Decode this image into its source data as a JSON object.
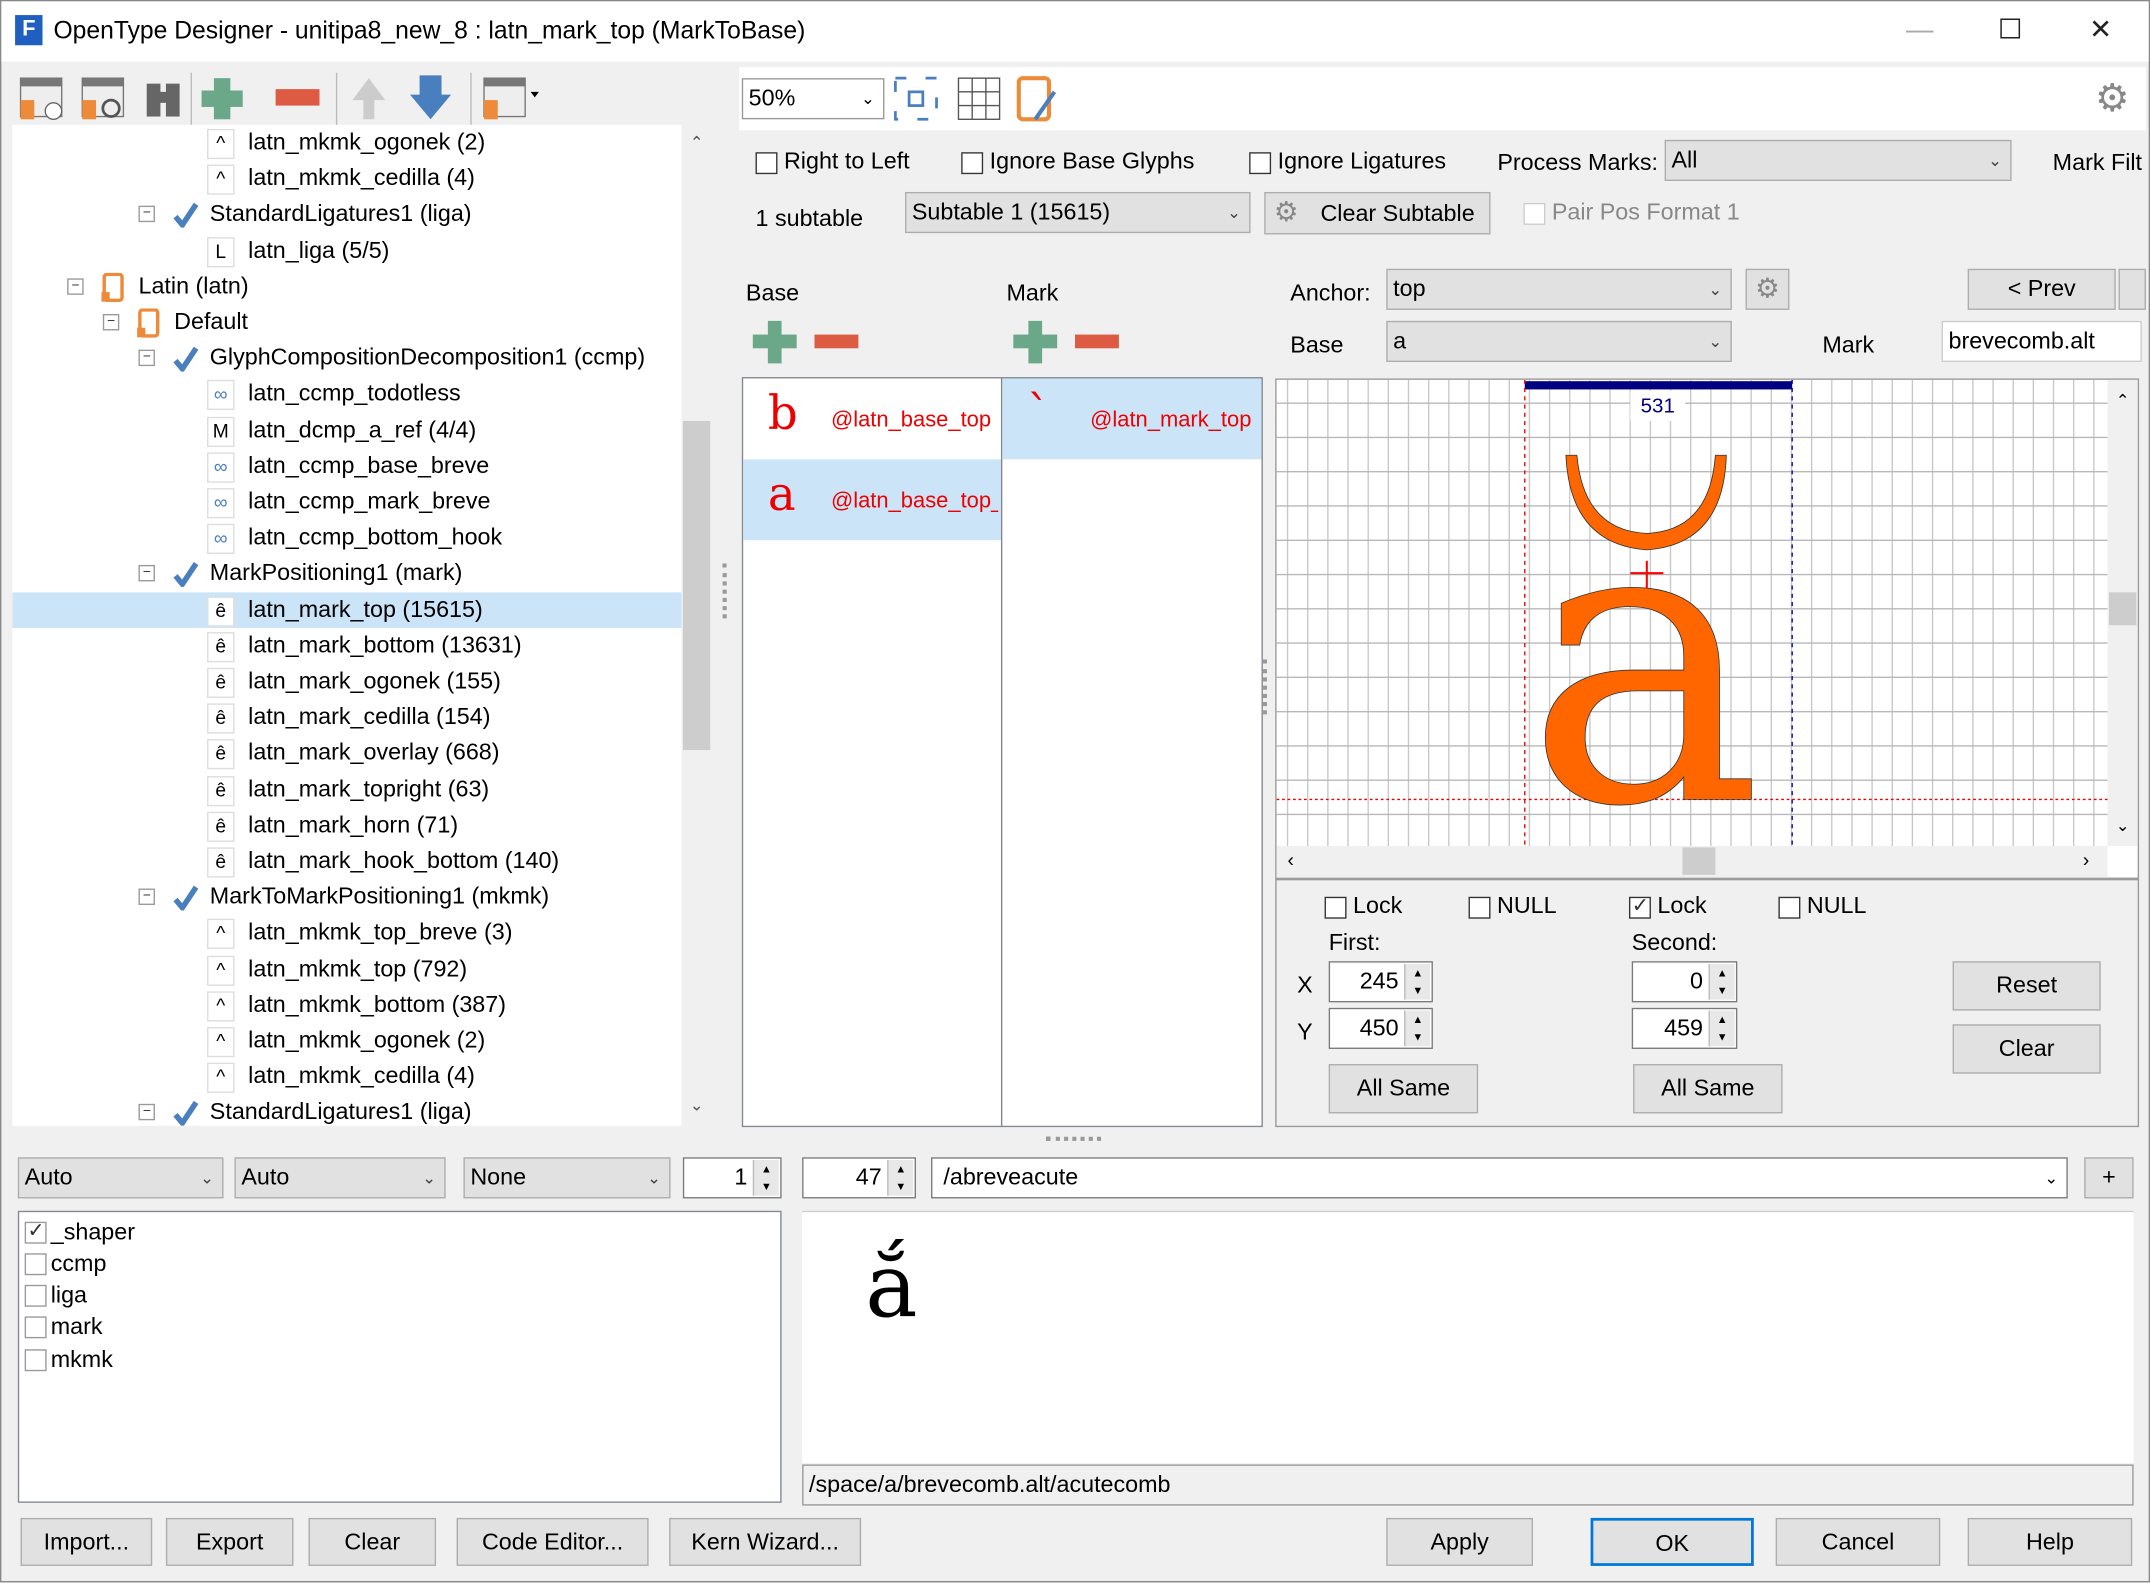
{
  "window": {
    "title": "OpenType Designer - unitipa8_new_8 : latn_mark_top (MarkToBase)",
    "minimize": "—",
    "maximize": "☐",
    "close": "✕"
  },
  "colors": {
    "accent_orange": "#ff6600",
    "selection": "#cce4f7",
    "anchor_red": "#ff0000",
    "advance_bar": "#000080",
    "add_green": "#6aa889",
    "remove_red": "#dd5a43"
  },
  "toolbar_left": [
    "new-lookup-icon",
    "find-lookup-icon",
    "binoculars-icon",
    "add-icon",
    "remove-icon",
    "move-up-icon",
    "move-down-icon",
    "view-menu-icon"
  ],
  "tree": [
    {
      "label": "latn_mkmk_ogonek (2)",
      "depth": 3,
      "icon": "mkmk"
    },
    {
      "label": "latn_mkmk_cedilla (4)",
      "depth": 3,
      "icon": "mkmk"
    },
    {
      "label": "StandardLigatures1 (liga)",
      "depth": 2,
      "icon": "feature"
    },
    {
      "label": "latn_liga (5/5)",
      "depth": 3,
      "icon": "liga"
    },
    {
      "label": "Latin (latn)",
      "depth": 0,
      "icon": "script"
    },
    {
      "label": "Default",
      "depth": 1,
      "icon": "script"
    },
    {
      "label": "GlyphCompositionDecomposition1 (ccmp)",
      "depth": 2,
      "icon": "feature"
    },
    {
      "label": "latn_ccmp_todotless",
      "depth": 3,
      "icon": "ccmp"
    },
    {
      "label": "latn_dcmp_a_ref (4/4)",
      "depth": 3,
      "icon": "multi"
    },
    {
      "label": "latn_ccmp_base_breve",
      "depth": 3,
      "icon": "ccmp"
    },
    {
      "label": "latn_ccmp_mark_breve",
      "depth": 3,
      "icon": "ccmp"
    },
    {
      "label": "latn_ccmp_bottom_hook",
      "depth": 3,
      "icon": "ccmp"
    },
    {
      "label": "MarkPositioning1 (mark)",
      "depth": 2,
      "icon": "feature"
    },
    {
      "label": "latn_mark_top (15615)",
      "depth": 3,
      "icon": "mark",
      "selected": true
    },
    {
      "label": "latn_mark_bottom (13631)",
      "depth": 3,
      "icon": "mark"
    },
    {
      "label": "latn_mark_ogonek (155)",
      "depth": 3,
      "icon": "mark"
    },
    {
      "label": "latn_mark_cedilla (154)",
      "depth": 3,
      "icon": "mark"
    },
    {
      "label": "latn_mark_overlay (668)",
      "depth": 3,
      "icon": "mark"
    },
    {
      "label": "latn_mark_topright (63)",
      "depth": 3,
      "icon": "mark"
    },
    {
      "label": "latn_mark_horn (71)",
      "depth": 3,
      "icon": "mark"
    },
    {
      "label": "latn_mark_hook_bottom (140)",
      "depth": 3,
      "icon": "mark"
    },
    {
      "label": "MarkToMarkPositioning1 (mkmk)",
      "depth": 2,
      "icon": "feature"
    },
    {
      "label": "latn_mkmk_top_breve (3)",
      "depth": 3,
      "icon": "mkmk"
    },
    {
      "label": "latn_mkmk_top (792)",
      "depth": 3,
      "icon": "mkmk"
    },
    {
      "label": "latn_mkmk_bottom (387)",
      "depth": 3,
      "icon": "mkmk"
    },
    {
      "label": "latn_mkmk_ogonek (2)",
      "depth": 3,
      "icon": "mkmk"
    },
    {
      "label": "latn_mkmk_cedilla (4)",
      "depth": 3,
      "icon": "mkmk"
    },
    {
      "label": "StandardLigatures1 (liga)",
      "depth": 2,
      "icon": "feature"
    }
  ],
  "right_toolbar": {
    "zoom": "50%"
  },
  "options": {
    "right_to_left": "Right to Left",
    "ignore_base": "Ignore Base Glyphs",
    "ignore_lig": "Ignore Ligatures",
    "process_marks_label": "Process Marks:",
    "process_marks_value": "All",
    "mark_filter": "Mark Filt",
    "subtable_count": "1 subtable",
    "subtable_value": "Subtable 1 (15615)",
    "clear_subtable": "Clear Subtable",
    "pair_pos_format": "Pair Pos Format 1"
  },
  "classes": {
    "base_header": "Base",
    "mark_header": "Mark",
    "base_items": [
      {
        "glyph": "b",
        "label": "@latn_base_top"
      },
      {
        "glyph": "a",
        "label": "@latn_base_top_",
        "selected": true
      }
    ],
    "mark_items": [
      {
        "glyph": "`",
        "label": "@latn_mark_top",
        "selected": true
      }
    ]
  },
  "anchor": {
    "label": "Anchor:",
    "value": "top",
    "base_label": "Base",
    "base_value": "a",
    "mark_label": "Mark",
    "mark_value": "brevecomb.alt",
    "prev": "< Prev"
  },
  "canvas": {
    "advance_width": "531"
  },
  "coords": {
    "lock1": "Lock",
    "null1": "NULL",
    "lock2": "Lock",
    "null2": "NULL",
    "lock2_checked": true,
    "first": "First:",
    "second": "Second:",
    "x_label": "X",
    "y_label": "Y",
    "first_x": "245",
    "first_y": "450",
    "second_x": "0",
    "second_y": "459",
    "all_same": "All Same",
    "reset": "Reset",
    "clear": "Clear"
  },
  "preview": {
    "script": "Auto",
    "language": "Auto",
    "direction": "None",
    "count": "1",
    "size": "47",
    "text": "/abreveacute",
    "plus": "+",
    "features": [
      {
        "label": "_shaper",
        "checked": true
      },
      {
        "label": "ccmp",
        "checked": false
      },
      {
        "label": "liga",
        "checked": false
      },
      {
        "label": "mark",
        "checked": false
      },
      {
        "label": "mkmk",
        "checked": false
      }
    ],
    "rendered": "ắ",
    "glyph_run": "/space/a/brevecomb.alt/acutecomb"
  },
  "buttons": {
    "import": "Import...",
    "export": "Export",
    "clear": "Clear",
    "code_editor": "Code Editor...",
    "kern_wizard": "Kern Wizard...",
    "apply": "Apply",
    "ok": "OK",
    "cancel": "Cancel",
    "help": "Help"
  }
}
